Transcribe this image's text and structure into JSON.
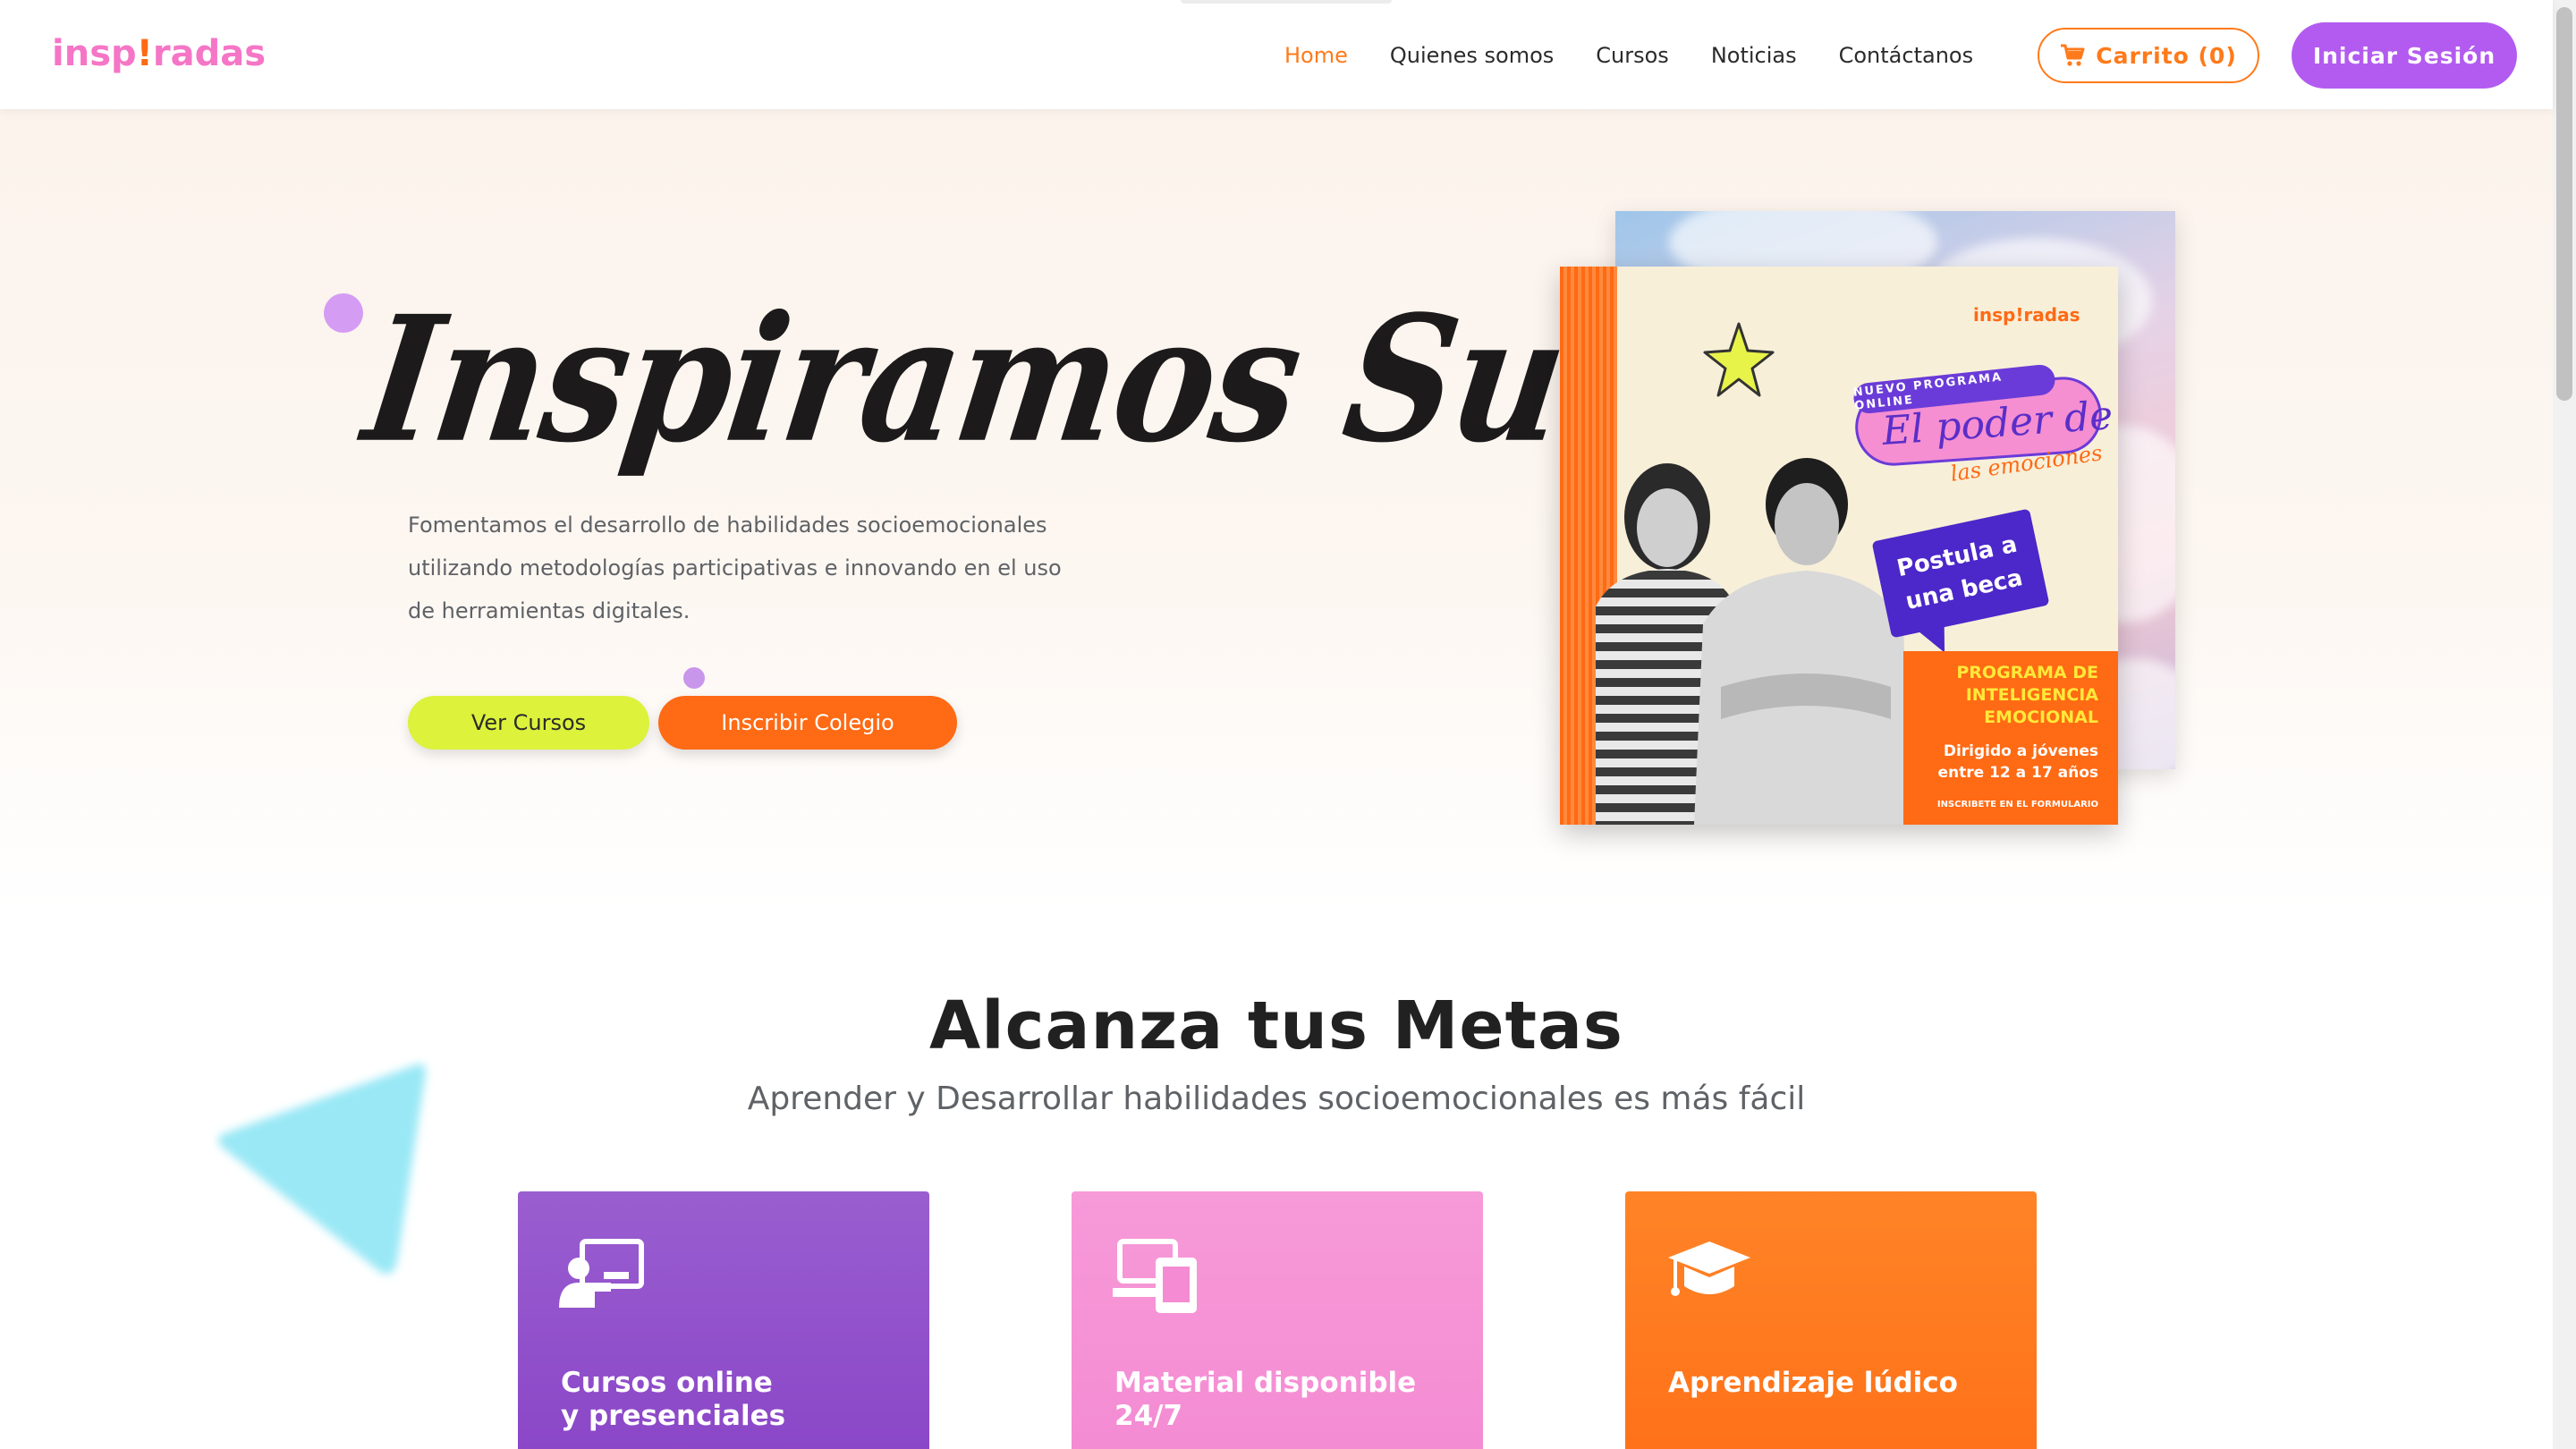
{
  "brand": {
    "logo_pre": "insp",
    "logo_bang": "!",
    "logo_post": "radas"
  },
  "nav": {
    "items": [
      {
        "label": "Home",
        "active": true
      },
      {
        "label": "Quienes somos",
        "active": false
      },
      {
        "label": "Cursos",
        "active": false
      },
      {
        "label": "Noticias",
        "active": false
      },
      {
        "label": "Contáctanos",
        "active": false
      }
    ],
    "cart_label": "Carrito (0)",
    "login_label": "Iniciar Sesión"
  },
  "hero": {
    "title": "Inspiramos Sueños",
    "description": "Fomentamos el desarrollo de habilidades socioemocionales utilizando metodologías participativas e innovando en el uso de herramientas digitales.",
    "btn_courses": "Ver Cursos",
    "btn_school": "Inscribir Colegio"
  },
  "poster": {
    "logo": "insp!radas",
    "tag": "NUEVO PROGRAMA ONLINE",
    "script_title": "El poder de",
    "script_sub": "las emociones",
    "bubble_line1": "Postula a",
    "bubble_line2": "una beca",
    "program_title": "PROGRAMA DE INTELIGENCIA EMOCIONAL",
    "program_target": "Dirigido a jóvenes entre 12 a 17 años",
    "program_cta": "INSCRIBETE EN EL FORMULARIO"
  },
  "goals": {
    "title": "Alcanza tus Metas",
    "subtitle": "Aprender y Desarrollar habilidades socioemocionales es más fácil",
    "cards": [
      {
        "title": "Cursos online\ny presenciales",
        "icon": "teacher-screen-icon",
        "color": "#8a46c7"
      },
      {
        "title": "Material disponible\n24/7",
        "icon": "devices-icon",
        "color": "#f48bd3"
      },
      {
        "title": "Aprendizaje lúdico",
        "icon": "graduation-cap-icon",
        "color": "#ff7118"
      }
    ]
  },
  "colors": {
    "accent_orange": "#ff7a1a",
    "accent_purple": "#b35bf0",
    "accent_lime": "#dcf23b",
    "accent_pink": "#f576c6"
  }
}
